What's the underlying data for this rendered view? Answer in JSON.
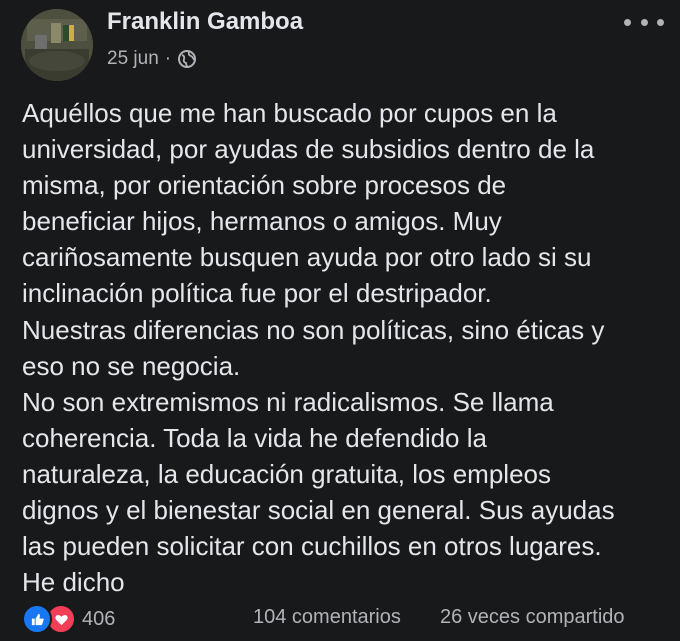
{
  "post": {
    "author": "Franklin Gamboa",
    "date": "25 jun",
    "separator": "·",
    "privacy_icon": "globe-icon",
    "more_icon": "more-dots-icon",
    "body_lines": [
      "Aquéllos que me han buscado por cupos en la",
      "universidad, por ayudas de subsidios dentro de la",
      "misma, por orientación sobre procesos de",
      "beneficiar hijos, hermanos o amigos. Muy",
      "cariñosamente busquen ayuda por otro lado si su",
      "inclinación política fue por el destripador.",
      "Nuestras diferencias no son políticas, sino éticas y",
      "eso no se negocia.",
      "No son extremismos ni radicalismos. Se llama",
      "coherencia. Toda la vida he defendido la",
      "naturaleza, la educación gratuita, los empleos",
      "dignos y el bienestar social en general. Sus ayudas",
      "las pueden solicitar con cuchillos en otros lugares.",
      "He dicho"
    ]
  },
  "footer": {
    "reaction_icons": [
      "like-icon",
      "love-icon"
    ],
    "reactions_count": "406",
    "comments_label": "104 comentarios",
    "shares_label": "26 veces compartido"
  },
  "colors": {
    "background": "#18191a",
    "primary_text": "#e4e6eb",
    "secondary_text": "#b0b3b8",
    "like_blue": "#1877f2",
    "love_red": "#f33e58"
  }
}
